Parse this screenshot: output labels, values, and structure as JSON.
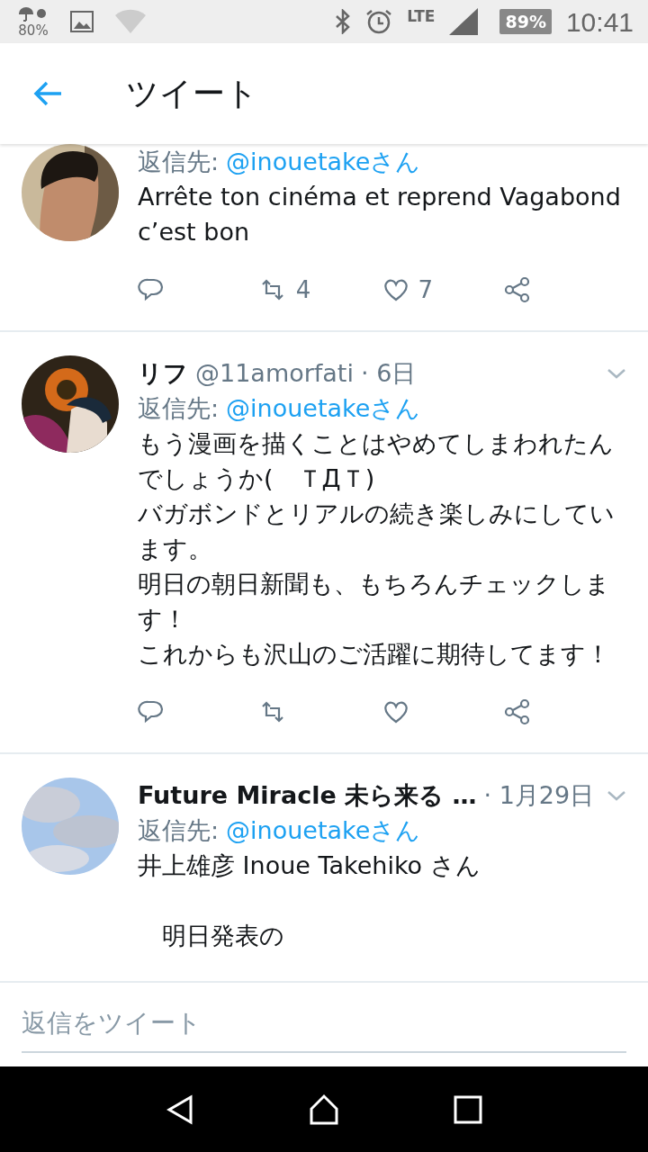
{
  "status_bar": {
    "weather_reading": "80%",
    "network": "LTE",
    "battery": "89%",
    "time": "10:41"
  },
  "header": {
    "title": "ツイート"
  },
  "tweets": [
    {
      "reply_label": "返信先:",
      "reply_to": "@inouetakeさん",
      "paragraphs": [
        "Arrête ton cinéma et reprend Vagabond c’est bon"
      ],
      "actions": [
        {
          "kind": "reply"
        },
        {
          "kind": "retweet",
          "count": "4"
        },
        {
          "kind": "like",
          "count": "7"
        },
        {
          "kind": "share"
        }
      ]
    },
    {
      "name": "リフ",
      "handle": "@11amorfati",
      "date": "· 6日",
      "reply_label": "返信先:",
      "reply_to": "@inouetakeさん",
      "paragraphs": [
        "もう漫画を描くことはやめてしまわれたんでしょうか(　ＴДＴ)",
        "バガボンドとリアルの続き楽しみにしています。",
        "明日の朝日新聞も、もちろんチェックします！",
        "これからも沢山のご活躍に期待してます！"
      ],
      "actions": [
        {
          "kind": "reply"
        },
        {
          "kind": "retweet"
        },
        {
          "kind": "like"
        },
        {
          "kind": "share"
        }
      ]
    },
    {
      "name": "Future Miracle 未ら来る …",
      "date": "· 1月29日",
      "reply_label": "返信先:",
      "reply_to": "@inouetakeさん",
      "paragraphs": [
        {
          "text": "井上雄彦 Inoue Takehiko さん",
          "blank_line_before": false
        },
        {
          "text": "　明日発表の",
          "blank_line_before": true
        }
      ]
    }
  ],
  "compose": {
    "placeholder": "返信をツイート"
  }
}
